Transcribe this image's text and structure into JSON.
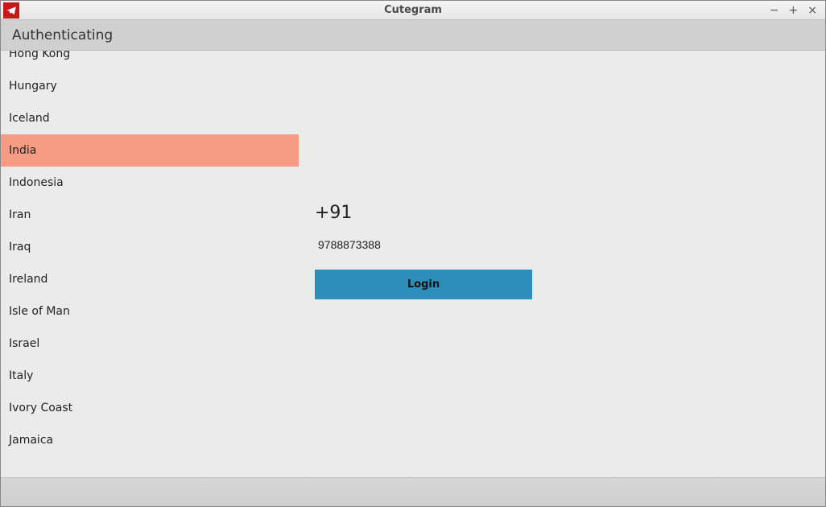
{
  "window": {
    "title": "Cutegram",
    "app_icon": "telegram-icon"
  },
  "header": {
    "title": "Authenticating"
  },
  "countries": {
    "items": [
      "Hong Kong",
      "Hungary",
      "Iceland",
      "India",
      "Indonesia",
      "Iran",
      "Iraq",
      "Ireland",
      "Isle of Man",
      "Israel",
      "Italy",
      "Ivory Coast",
      "Jamaica"
    ],
    "selected_index": 3
  },
  "login": {
    "dial_code": "+91",
    "phone_value": "9788873388",
    "login_label": "Login"
  }
}
